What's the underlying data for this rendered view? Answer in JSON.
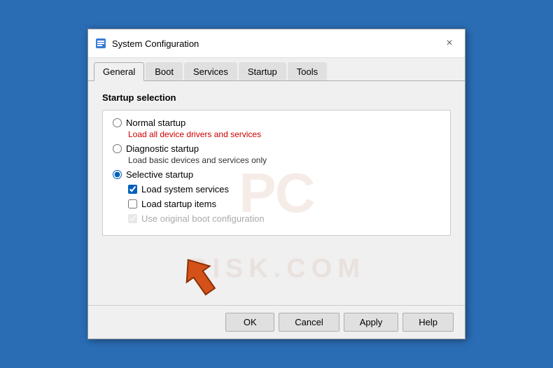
{
  "window": {
    "title": "System Configuration",
    "icon": "⚙",
    "close_label": "×"
  },
  "tabs": [
    {
      "label": "General",
      "active": true
    },
    {
      "label": "Boot",
      "active": false
    },
    {
      "label": "Services",
      "active": false
    },
    {
      "label": "Startup",
      "active": false
    },
    {
      "label": "Tools",
      "active": false
    }
  ],
  "content": {
    "section_label": "Startup selection",
    "options": [
      {
        "id": "normal",
        "label": "Normal startup",
        "desc": "Load all device drivers and services",
        "desc_class": "red",
        "checked": false
      },
      {
        "id": "diagnostic",
        "label": "Diagnostic startup",
        "desc": "Load basic devices and services only",
        "desc_class": "",
        "checked": false
      },
      {
        "id": "selective",
        "label": "Selective startup",
        "desc": "",
        "checked": true
      }
    ],
    "selective_items": [
      {
        "label": "Load system services",
        "checked": true,
        "disabled": false
      },
      {
        "label": "Load startup items",
        "checked": false,
        "disabled": false
      },
      {
        "label": "Use original boot configuration",
        "checked": true,
        "disabled": true
      }
    ]
  },
  "footer": {
    "ok_label": "OK",
    "cancel_label": "Cancel",
    "apply_label": "Apply",
    "help_label": "Help"
  },
  "watermark": {
    "line1": "PC",
    "line2": "RISK.COM"
  }
}
